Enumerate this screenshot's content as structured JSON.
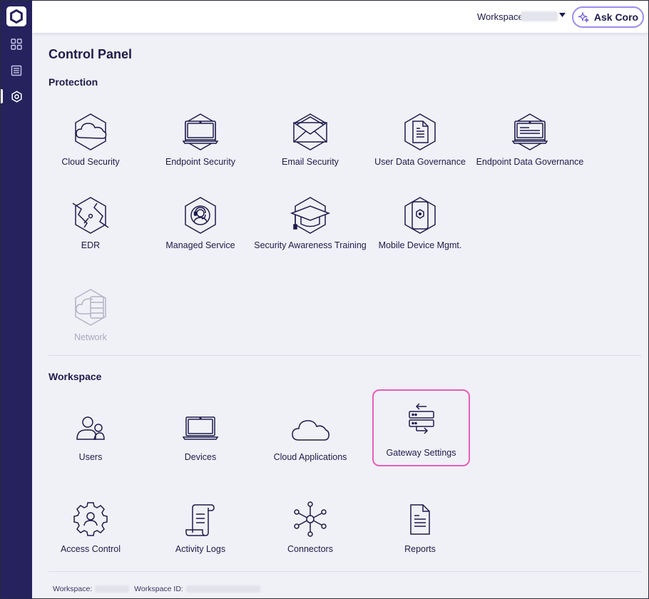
{
  "topbar": {
    "workspace_label": "Workspace:",
    "ask_button": "Ask Coro"
  },
  "sidebar": {
    "items": [
      {
        "icon": "dashboard-icon"
      },
      {
        "icon": "list-icon"
      },
      {
        "icon": "control-panel-icon",
        "active": true
      }
    ]
  },
  "page": {
    "title": "Control Panel"
  },
  "protection": {
    "title": "Protection",
    "items": [
      {
        "label": "Cloud Security",
        "icon": "cloud-security-icon"
      },
      {
        "label": "Endpoint Security",
        "icon": "endpoint-security-icon"
      },
      {
        "label": "Email Security",
        "icon": "email-security-icon"
      },
      {
        "label": "User Data Governance",
        "icon": "user-data-governance-icon"
      },
      {
        "label": "Endpoint Data Governance",
        "icon": "endpoint-data-governance-icon"
      },
      {
        "label": "EDR",
        "icon": "edr-icon"
      },
      {
        "label": "Managed Service",
        "icon": "managed-service-icon"
      },
      {
        "label": "Security Awareness Training",
        "icon": "security-awareness-training-icon"
      },
      {
        "label": "Mobile Device Mgmt.",
        "icon": "mobile-device-mgmt-icon"
      },
      {
        "label": "Network",
        "icon": "network-icon",
        "disabled": true
      }
    ]
  },
  "workspace": {
    "title": "Workspace",
    "items": [
      {
        "label": "Users",
        "icon": "users-icon"
      },
      {
        "label": "Devices",
        "icon": "devices-icon"
      },
      {
        "label": "Cloud Applications",
        "icon": "cloud-applications-icon"
      },
      {
        "label": "Gateway Settings",
        "icon": "gateway-settings-icon",
        "highlighted": true
      },
      {
        "label": "Access Control",
        "icon": "access-control-icon"
      },
      {
        "label": "Activity Logs",
        "icon": "activity-logs-icon"
      },
      {
        "label": "Connectors",
        "icon": "connectors-icon"
      },
      {
        "label": "Reports",
        "icon": "reports-icon"
      }
    ]
  },
  "footer": {
    "workspace_label": "Workspace:",
    "workspace_id_label": "Workspace ID:"
  },
  "colors": {
    "sidebar": "#25225e",
    "accent": "#1e1b4b",
    "highlight": "#e85dbb",
    "ask_border": "#9b8cf0"
  }
}
